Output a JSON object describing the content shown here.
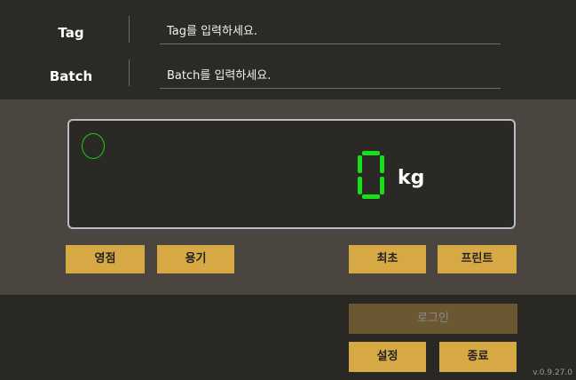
{
  "tag_field": {
    "label": "Tag",
    "placeholder": "Tag를 입력하세요."
  },
  "batch_field": {
    "label": "Batch",
    "placeholder": "Batch를 입력하세요."
  },
  "display": {
    "weight": "0",
    "unit": "kg",
    "digit_color": "#18e018"
  },
  "buttons": {
    "zero": "영점",
    "container": "용기",
    "initial": "최초",
    "print": "프린트",
    "login": "로그인",
    "settings": "설정",
    "exit": "종료"
  },
  "version": "v.0.9.27.0",
  "colors": {
    "button": "#d7a944",
    "button_disabled": "#6b5832",
    "panel": "#4a463f"
  }
}
